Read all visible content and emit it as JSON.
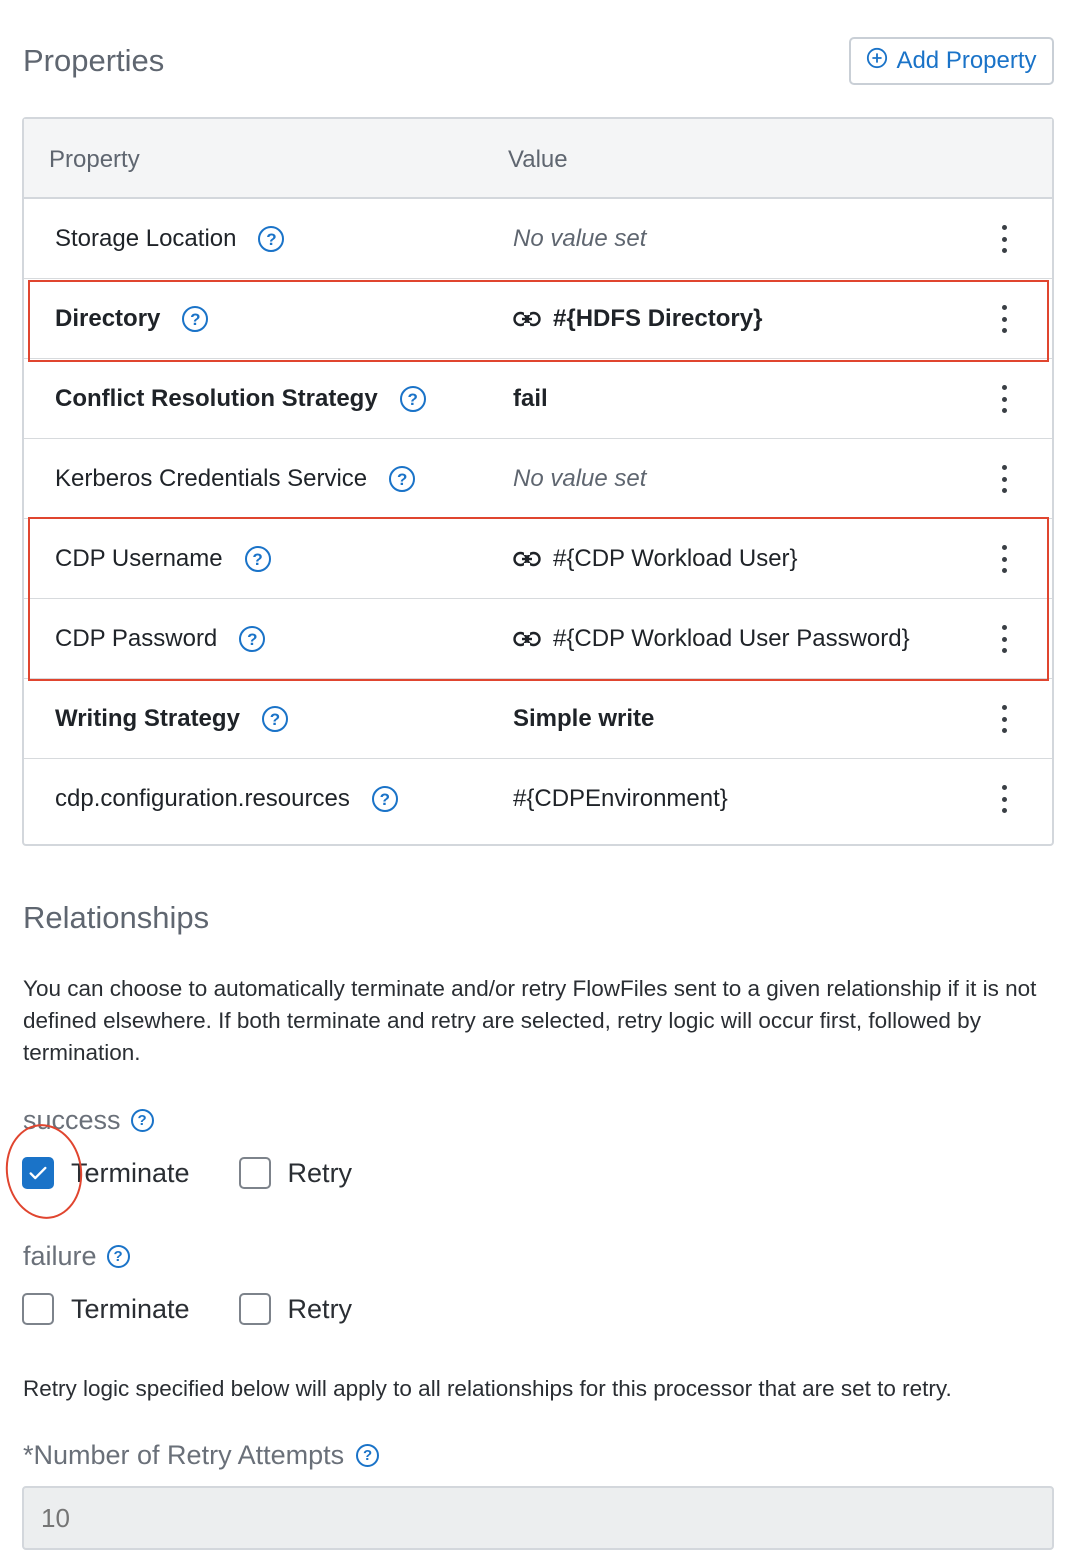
{
  "properties": {
    "title": "Properties",
    "add_button": "Add Property",
    "header": {
      "property": "Property",
      "value": "Value"
    },
    "rows": [
      {
        "name": "Storage Location",
        "value": "No value set",
        "bold": false,
        "empty": true,
        "link": false
      },
      {
        "name": "Directory",
        "value": "#{HDFS Directory}",
        "bold": true,
        "empty": false,
        "link": true
      },
      {
        "name": "Conflict Resolution Strategy",
        "value": "fail",
        "bold": true,
        "empty": false,
        "link": false
      },
      {
        "name": "Kerberos Credentials Service",
        "value": "No value set",
        "bold": false,
        "empty": true,
        "link": false
      },
      {
        "name": "CDP Username",
        "value": "#{CDP Workload User}",
        "bold": false,
        "empty": false,
        "link": true
      },
      {
        "name": "CDP Password",
        "value": "#{CDP Workload User Password}",
        "bold": false,
        "empty": false,
        "link": true
      },
      {
        "name": "Writing Strategy",
        "value": "Simple write",
        "bold": true,
        "empty": false,
        "link": false
      },
      {
        "name": "cdp.configuration.resources",
        "value": "#{CDPEnvironment}",
        "bold": false,
        "empty": false,
        "link": false
      }
    ]
  },
  "relationships": {
    "title": "Relationships",
    "description": "You can choose to automatically terminate and/or retry FlowFiles sent to a given relationship if it is not defined elsewhere. If both terminate and retry are selected, retry logic will occur first, followed by termination.",
    "items": [
      {
        "name": "success",
        "terminate_label": "Terminate",
        "terminate_checked": true,
        "retry_label": "Retry",
        "retry_checked": false
      },
      {
        "name": "failure",
        "terminate_label": "Terminate",
        "terminate_checked": false,
        "retry_label": "Retry",
        "retry_checked": false
      }
    ],
    "retry_note": "Retry logic specified below will apply to all relationships for this processor that are set to retry.",
    "retry_attempts": {
      "label": "*Number of Retry Attempts",
      "placeholder": "10"
    }
  },
  "icons": {
    "help": "?",
    "add": "plus-circle-icon",
    "link": "link-icon",
    "menu": "kebab-menu-icon",
    "check": "checkmark-icon"
  },
  "colors": {
    "accent": "#1a73c8",
    "annotation": "#e0452f"
  }
}
